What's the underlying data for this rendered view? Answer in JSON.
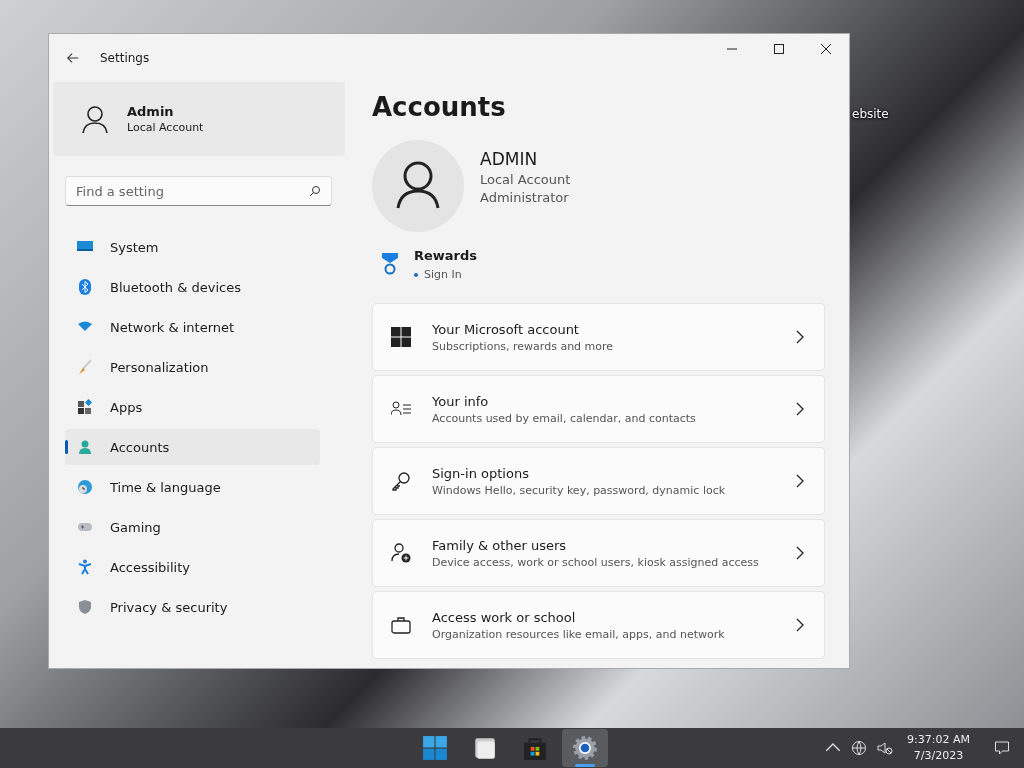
{
  "desktop": {
    "icon_label": "ebsite"
  },
  "window": {
    "title": "Settings"
  },
  "user": {
    "name": "Admin",
    "type": "Local Account"
  },
  "search": {
    "placeholder": "Find a setting"
  },
  "nav": [
    {
      "label": "System",
      "kind": "system",
      "selected": false
    },
    {
      "label": "Bluetooth & devices",
      "kind": "bluetooth",
      "selected": false
    },
    {
      "label": "Network & internet",
      "kind": "wifi",
      "selected": false
    },
    {
      "label": "Personalization",
      "kind": "brush",
      "selected": false
    },
    {
      "label": "Apps",
      "kind": "apps",
      "selected": false
    },
    {
      "label": "Accounts",
      "kind": "person",
      "selected": true
    },
    {
      "label": "Time & language",
      "kind": "globe",
      "selected": false
    },
    {
      "label": "Gaming",
      "kind": "gamepad",
      "selected": false
    },
    {
      "label": "Accessibility",
      "kind": "accessibility",
      "selected": false
    },
    {
      "label": "Privacy & security",
      "kind": "shield",
      "selected": false
    }
  ],
  "page": {
    "title": "Accounts",
    "profile": {
      "name": "ADMIN",
      "lines": [
        "Local Account",
        "Administrator"
      ]
    },
    "rewards": {
      "title": "Rewards",
      "status": "Sign In"
    }
  },
  "cards": [
    {
      "kind": "windows",
      "title": "Your Microsoft account",
      "subtitle": "Subscriptions, rewards and more"
    },
    {
      "kind": "info",
      "title": "Your info",
      "subtitle": "Accounts used by email, calendar, and contacts"
    },
    {
      "kind": "key",
      "title": "Sign-in options",
      "subtitle": "Windows Hello, security key, password, dynamic lock"
    },
    {
      "kind": "family",
      "title": "Family & other users",
      "subtitle": "Device access, work or school users, kiosk assigned access"
    },
    {
      "kind": "briefcase",
      "title": "Access work or school",
      "subtitle": "Organization resources like email, apps, and network"
    }
  ],
  "taskbar": {
    "apps": [
      {
        "kind": "start",
        "selected": false
      },
      {
        "kind": "folder",
        "selected": false
      },
      {
        "kind": "store",
        "selected": false
      },
      {
        "kind": "gear",
        "selected": true
      }
    ],
    "time": "9:37:02 AM",
    "date": "7/3/2023"
  }
}
